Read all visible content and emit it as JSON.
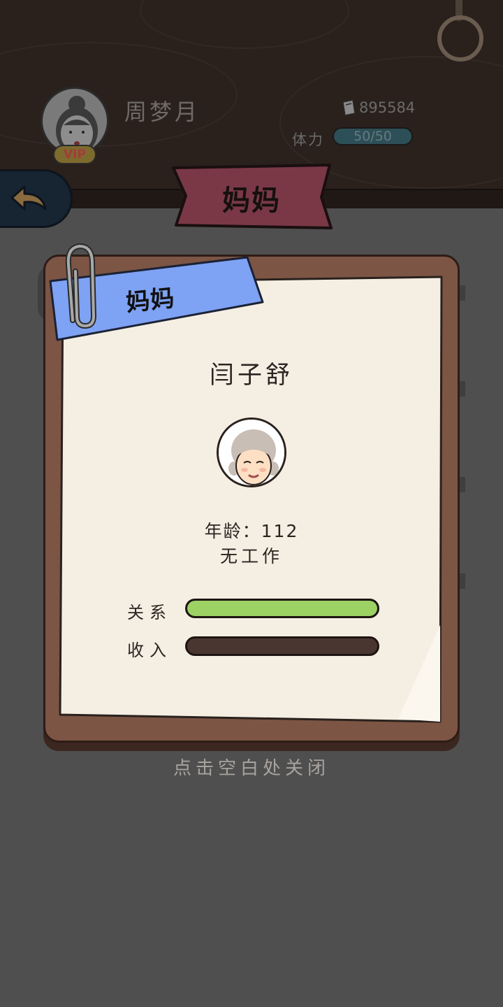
{
  "header": {
    "player_name": "周梦月",
    "vip_label": "VIP",
    "money": "895584",
    "stamina_label": "体力",
    "stamina_value": "50/50"
  },
  "top_ribbon": {
    "title": "妈妈"
  },
  "card": {
    "ribbon_label": "妈妈",
    "name": "闫子舒",
    "age_line": "年龄：112",
    "job_line": "无工作",
    "stats": [
      {
        "label": "关系",
        "fraction": 1.0,
        "color": "#9cd264"
      },
      {
        "label": "收入",
        "fraction": 0.0,
        "color": "#9cd264"
      }
    ]
  },
  "close_hint": "点击空白处关闭",
  "icons": {
    "back": "arrow-left-icon",
    "money": "ticket-icon",
    "ring": "ring-icon",
    "clip": "paper-clip-icon"
  },
  "colors": {
    "card_frame": "#7c5545",
    "paper": "#f5efe3",
    "ribbon_blue": "#7ea2f4",
    "ribbon_red": "#7a3846",
    "relation_fill": "#9cd264",
    "back_button": "#172432"
  }
}
